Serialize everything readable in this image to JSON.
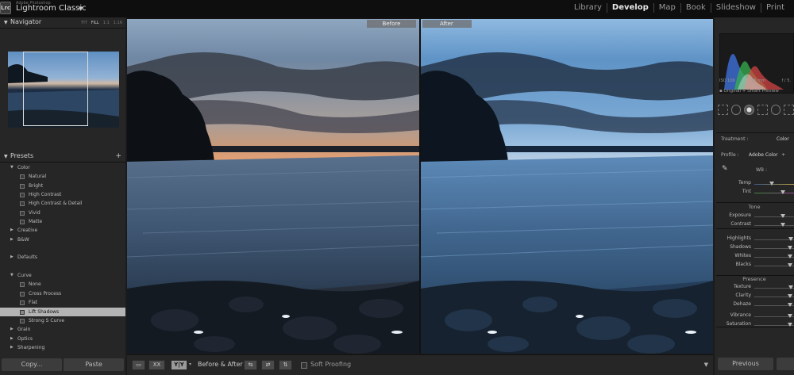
{
  "app": {
    "vendor": "Adobe Photoshop",
    "name": "Lightroom Classic",
    "logo": "Lrc",
    "caret": "▼"
  },
  "modules": [
    "Library",
    "Develop",
    "Map",
    "Book",
    "Slideshow",
    "Print"
  ],
  "active_module": "Develop",
  "navigator": {
    "title": "Navigator",
    "zoom_options": [
      "FIT",
      "FILL",
      "1:1",
      "1:16"
    ],
    "zoom_selected": "FILL"
  },
  "presets": {
    "title": "Presets",
    "add_icon": "+",
    "groups": [
      {
        "name": "Color",
        "expanded": true,
        "items": [
          "Natural",
          "Bright",
          "High Contrast",
          "High Contrast & Detail",
          "Vivid",
          "Matte"
        ]
      },
      {
        "name": "Creative",
        "expanded": false,
        "items": []
      },
      {
        "name": "B&W",
        "expanded": false,
        "items": []
      },
      {
        "name": "Defaults",
        "expanded": false,
        "items": []
      },
      {
        "name": "Curve",
        "expanded": true,
        "items": [
          "None",
          "Cross Process",
          "Flat",
          "Lift Shadows",
          "Strong S Curve"
        ]
      },
      {
        "name": "Grain",
        "expanded": false,
        "items": []
      },
      {
        "name": "Optics",
        "expanded": false,
        "items": []
      },
      {
        "name": "Sharpening",
        "expanded": false,
        "items": []
      }
    ],
    "selected_item": "Lift Shadows"
  },
  "buttons": {
    "copy": "Copy...",
    "paste": "Paste",
    "previous": "Previous"
  },
  "compare": {
    "before_label": "Before",
    "after_label": "After"
  },
  "toolbar": {
    "loupe_icon": "loupe-view-icon",
    "xx_label": "XX",
    "yy_label": "Y|Y",
    "before_after_label": "Before & After :",
    "soft_proofing_label": "Soft Proofing",
    "soft_proofing_checked": false
  },
  "histogram": {
    "iso": "ISO 100",
    "focal": "25 mm",
    "aperture": "f / 5.",
    "original": "Original + Smart Preview"
  },
  "basic": {
    "treatment_label": "Treatment :",
    "treatment_value": "Color",
    "profile_label": "Profile :",
    "profile_value": "Adobe Color",
    "profile_caret": "÷",
    "wb_label": "WB :",
    "tone_title": "Tone",
    "presence_title": "Presence",
    "sliders_wb": [
      {
        "name": "Temp",
        "value": 0.45
      },
      {
        "name": "Tint",
        "value": 0.75
      }
    ],
    "sliders_tone": [
      {
        "name": "Exposure",
        "value": 0.75
      },
      {
        "name": "Contrast",
        "value": 0.75
      }
    ],
    "sliders_tone2": [
      {
        "name": "Highlights",
        "value": 0.95
      },
      {
        "name": "Shadows",
        "value": 0.93
      },
      {
        "name": "Whites",
        "value": 0.93
      },
      {
        "name": "Blacks",
        "value": 0.93
      }
    ],
    "sliders_presence": [
      {
        "name": "Texture",
        "value": 0.95
      },
      {
        "name": "Clarity",
        "value": 0.93
      },
      {
        "name": "Dehaze",
        "value": 0.93
      }
    ],
    "sliders_presence2": [
      {
        "name": "Vibrance",
        "value": 0.93
      },
      {
        "name": "Saturation",
        "value": 0.93
      }
    ]
  },
  "colors": {
    "accent": "#e6e6e6",
    "panel": "#262626",
    "selected_row": "#b4b4b4"
  }
}
